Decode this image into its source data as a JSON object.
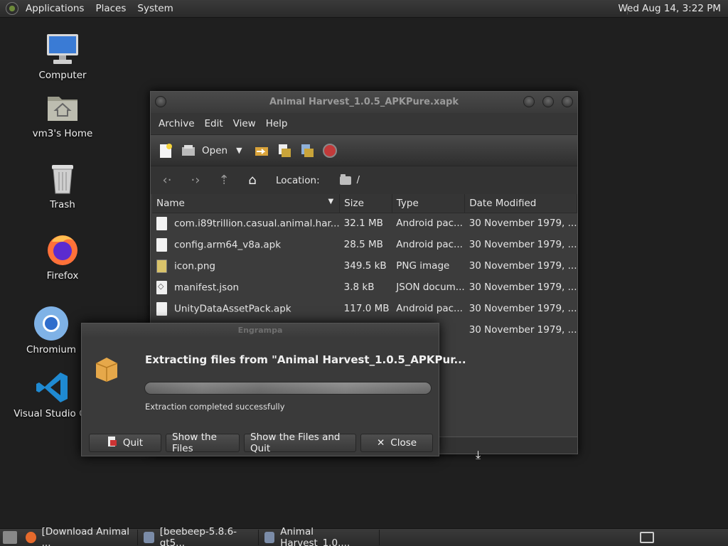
{
  "top_panel": {
    "menus": [
      "Applications",
      "Places",
      "System"
    ],
    "clock": "Wed Aug 14,  3:22 PM"
  },
  "desktop": {
    "icons": [
      {
        "label": "Computer",
        "icon": "monitor-icon"
      },
      {
        "label": "vm3's Home",
        "icon": "home-folder-icon"
      },
      {
        "label": "Trash",
        "icon": "trash-icon"
      },
      {
        "label": "Firefox",
        "icon": "firefox-icon"
      },
      {
        "label": "Chromium",
        "icon": "chromium-icon"
      },
      {
        "label": "Visual Studio Co",
        "icon": "vscode-icon"
      }
    ]
  },
  "window": {
    "title": "Animal Harvest_1.0.5_APKPure.xapk",
    "menus": [
      "Archive",
      "Edit",
      "View",
      "Help"
    ],
    "toolbar": {
      "open_label": "Open"
    },
    "location": {
      "label": "Location:",
      "path": "/"
    },
    "columns": [
      "Name",
      "Size",
      "Type",
      "Date Modified"
    ],
    "files": [
      {
        "name": "com.i89trillion.casual.animal.har...",
        "size": "32.1 MB",
        "type": "Android pac...",
        "date": "30 November 1979, ...",
        "icon": "file"
      },
      {
        "name": "config.arm64_v8a.apk",
        "size": "28.5 MB",
        "type": "Android pac...",
        "date": "30 November 1979, ...",
        "icon": "file"
      },
      {
        "name": "icon.png",
        "size": "349.5 kB",
        "type": "PNG image",
        "date": "30 November 1979, ...",
        "icon": "png"
      },
      {
        "name": "manifest.json",
        "size": "3.8 kB",
        "type": "JSON docum...",
        "date": "30 November 1979, ...",
        "icon": "json"
      },
      {
        "name": "UnityDataAssetPack.apk",
        "size": "117.0 MB",
        "type": "Android pac...",
        "date": "30 November 1979, ...",
        "icon": "file"
      },
      {
        "name": "",
        "size": "",
        "type": "pac...",
        "date": "30 November 1979, ...",
        "icon": "file"
      }
    ]
  },
  "dialog": {
    "title": "Engrampa",
    "heading": "Extracting files from \"Animal Harvest_1.0.5_APKPur...",
    "progress": 1.0,
    "status": "Extraction completed successfully",
    "buttons": {
      "quit": "Quit",
      "show_files": "Show the Files",
      "show_files_quit": "Show the Files and Quit",
      "close": "Close"
    }
  },
  "taskbar": {
    "tasks": [
      {
        "label": "[Download Animal ...",
        "icon": "firefox-icon"
      },
      {
        "label": "[beebeep-5.8.6-qt5...",
        "icon": "archive-icon"
      },
      {
        "label": "Animal Harvest_1.0....",
        "icon": "archive-icon"
      }
    ]
  }
}
